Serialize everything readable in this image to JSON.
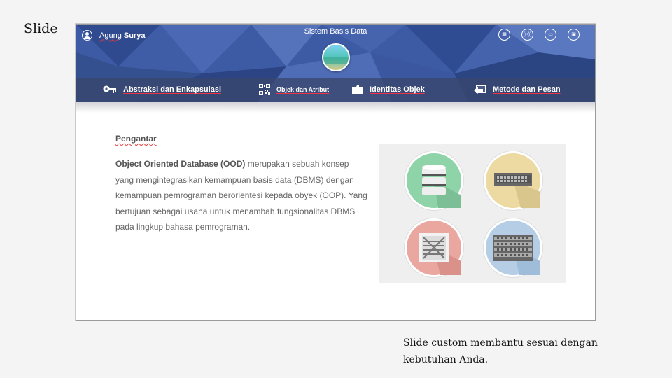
{
  "page_label": "Slide",
  "slide": {
    "user": {
      "first": "Agung",
      "last": "Surya"
    },
    "title": "Sistem Basis Data",
    "top_icons": [
      "grid-icon",
      "broadcast-icon",
      "card-icon",
      "calendar-icon"
    ],
    "nav": [
      {
        "label": "Abstraksi  dan Enkapsulasi",
        "icon": "key-icon"
      },
      {
        "label": "Objek dan Atribut",
        "icon": "qr-code-icon"
      },
      {
        "label": "Identitas Objek",
        "icon": "folder-icon"
      },
      {
        "label": "Metode dan Pesan",
        "icon": "reply-arrow-icon"
      }
    ],
    "content": {
      "heading": "Pengantar",
      "lead": "Object Oriented Database (OOD)",
      "body": " merupakan sebuah konsep yang mengintegrasikan  kemampuan basis data (DBMS) dengan kemampuan pemrograman berorientesi kepada obyek (OOP). Yang bertujuan  sebagai usaha untuk menambah fungsionalitas DBMS pada lingkup  bahasa pemrograman."
    },
    "illustrations": [
      "database-icon",
      "server-rack-icon",
      "fan-unit-icon",
      "server-stack-icon"
    ],
    "colors": {
      "banner": "#3b5aa3",
      "navbar": "#3a466e",
      "green": "#8fd3a9",
      "yellow": "#ecdaa2",
      "red": "#e9a7a0",
      "blue": "#b5cde5"
    }
  },
  "caption": "Slide custom membantu sesuai dengan kebutuhan Anda."
}
